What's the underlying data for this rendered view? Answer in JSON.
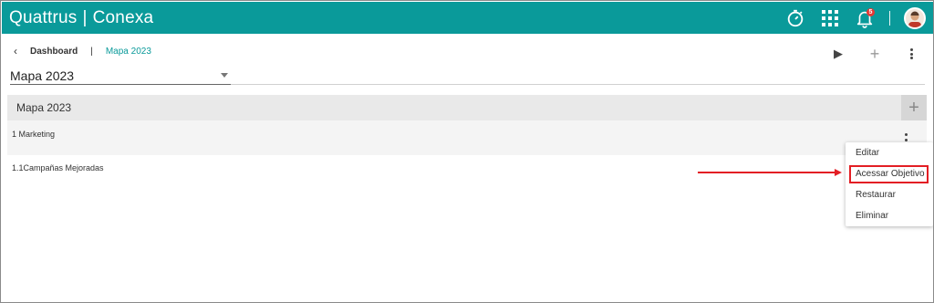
{
  "header": {
    "brand_left": "Quattrus",
    "brand_sep": "|",
    "brand_right": "Conexa",
    "icons": [
      "stopwatch-icon",
      "apps-grid-icon",
      "bell-icon",
      "avatar"
    ],
    "notification_count": "5",
    "colors": {
      "topbar": "#0a9a9a"
    }
  },
  "breadcrumb": {
    "back_icon": "‹",
    "dashboard": "Dashboard",
    "separator": "|",
    "current": "Mapa 2023"
  },
  "page_actions": {
    "play_icon": "▶",
    "add_icon": "+",
    "more_icon": "⋮"
  },
  "map_select": {
    "value": "Mapa 2023"
  },
  "section": {
    "title": "Mapa 2023",
    "add_icon": "+"
  },
  "rows": [
    {
      "label": "1 Marketing"
    },
    {
      "label": "1.1Campañas Mejoradas"
    }
  ],
  "context_menu": {
    "items": [
      "Editar",
      "Acessar Objetivo",
      "Restaurar",
      "Eliminar"
    ],
    "highlight_color": "#e31e24"
  }
}
